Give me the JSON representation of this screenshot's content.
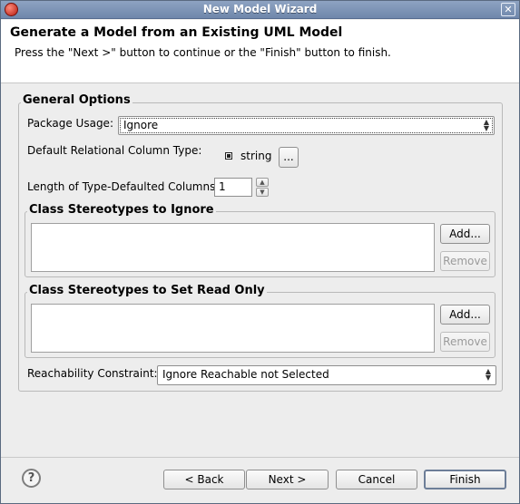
{
  "window": {
    "title": "New Model Wizard",
    "close_glyph": "✕"
  },
  "banner": {
    "title": "Generate a Model from an Existing UML Model",
    "message": "Press the \"Next >\" button to continue or the \"Finish\" button to finish."
  },
  "general_options": {
    "title": "General Options",
    "package_usage": {
      "label": "Package Usage:",
      "value": "Ignore"
    },
    "default_column_type": {
      "label": "Default Relational Column Type:",
      "value": "string",
      "browse_label": "..."
    },
    "length_columns": {
      "label": "Length of Type-Defaulted Columns:",
      "value": "1"
    },
    "stereotypes_ignore": {
      "title": "Class Stereotypes to Ignore",
      "add_label": "Add...",
      "remove_label": "Remove",
      "items": []
    },
    "stereotypes_readonly": {
      "title": "Class Stereotypes to Set Read Only",
      "add_label": "Add...",
      "remove_label": "Remove",
      "items": []
    },
    "reachability": {
      "label": "Reachability Constraint:",
      "value": "Ignore Reachable not Selected"
    }
  },
  "footer": {
    "help_glyph": "?",
    "back_label": "< Back",
    "next_label": "Next >",
    "cancel_label": "Cancel",
    "finish_label": "Finish"
  }
}
